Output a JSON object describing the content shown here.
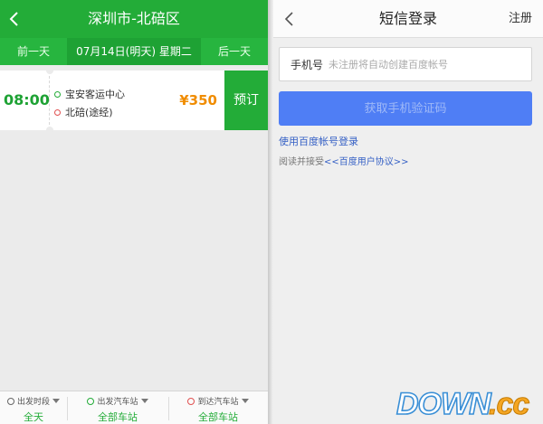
{
  "left": {
    "header": {
      "title": "深圳市-北碚区"
    },
    "date_bar": {
      "prev_label": "前一天",
      "current_date": "07月14日(明天) 星期二",
      "next_label": "后一天"
    },
    "trip": {
      "time": "08:00",
      "from_station": "宝安客运中心",
      "to_station": "北碚(途经)",
      "price": "¥350",
      "book_label": "预订"
    },
    "filters": [
      {
        "label": "出发时段",
        "value": "全天"
      },
      {
        "label": "出发汽车站",
        "value": "全部车站"
      },
      {
        "label": "到达汽车站",
        "value": "全部车站"
      }
    ],
    "colors": {
      "brand_green": "#23ac38",
      "price_orange": "#f08c00"
    }
  },
  "right": {
    "header": {
      "title": "短信登录",
      "register_label": "注册"
    },
    "phone": {
      "label": "手机号",
      "placeholder": "未注册将自动创建百度帐号"
    },
    "get_code_label": "获取手机验证码",
    "baidu_login_link": "使用百度帐号登录",
    "agreement": {
      "prefix": "阅读并接受",
      "link": "<<百度用户协议>>"
    },
    "colors": {
      "button_blue": "#4f7ef5",
      "link_blue": "#3560c5"
    }
  },
  "watermark": {
    "text": "DOWN.cc"
  }
}
